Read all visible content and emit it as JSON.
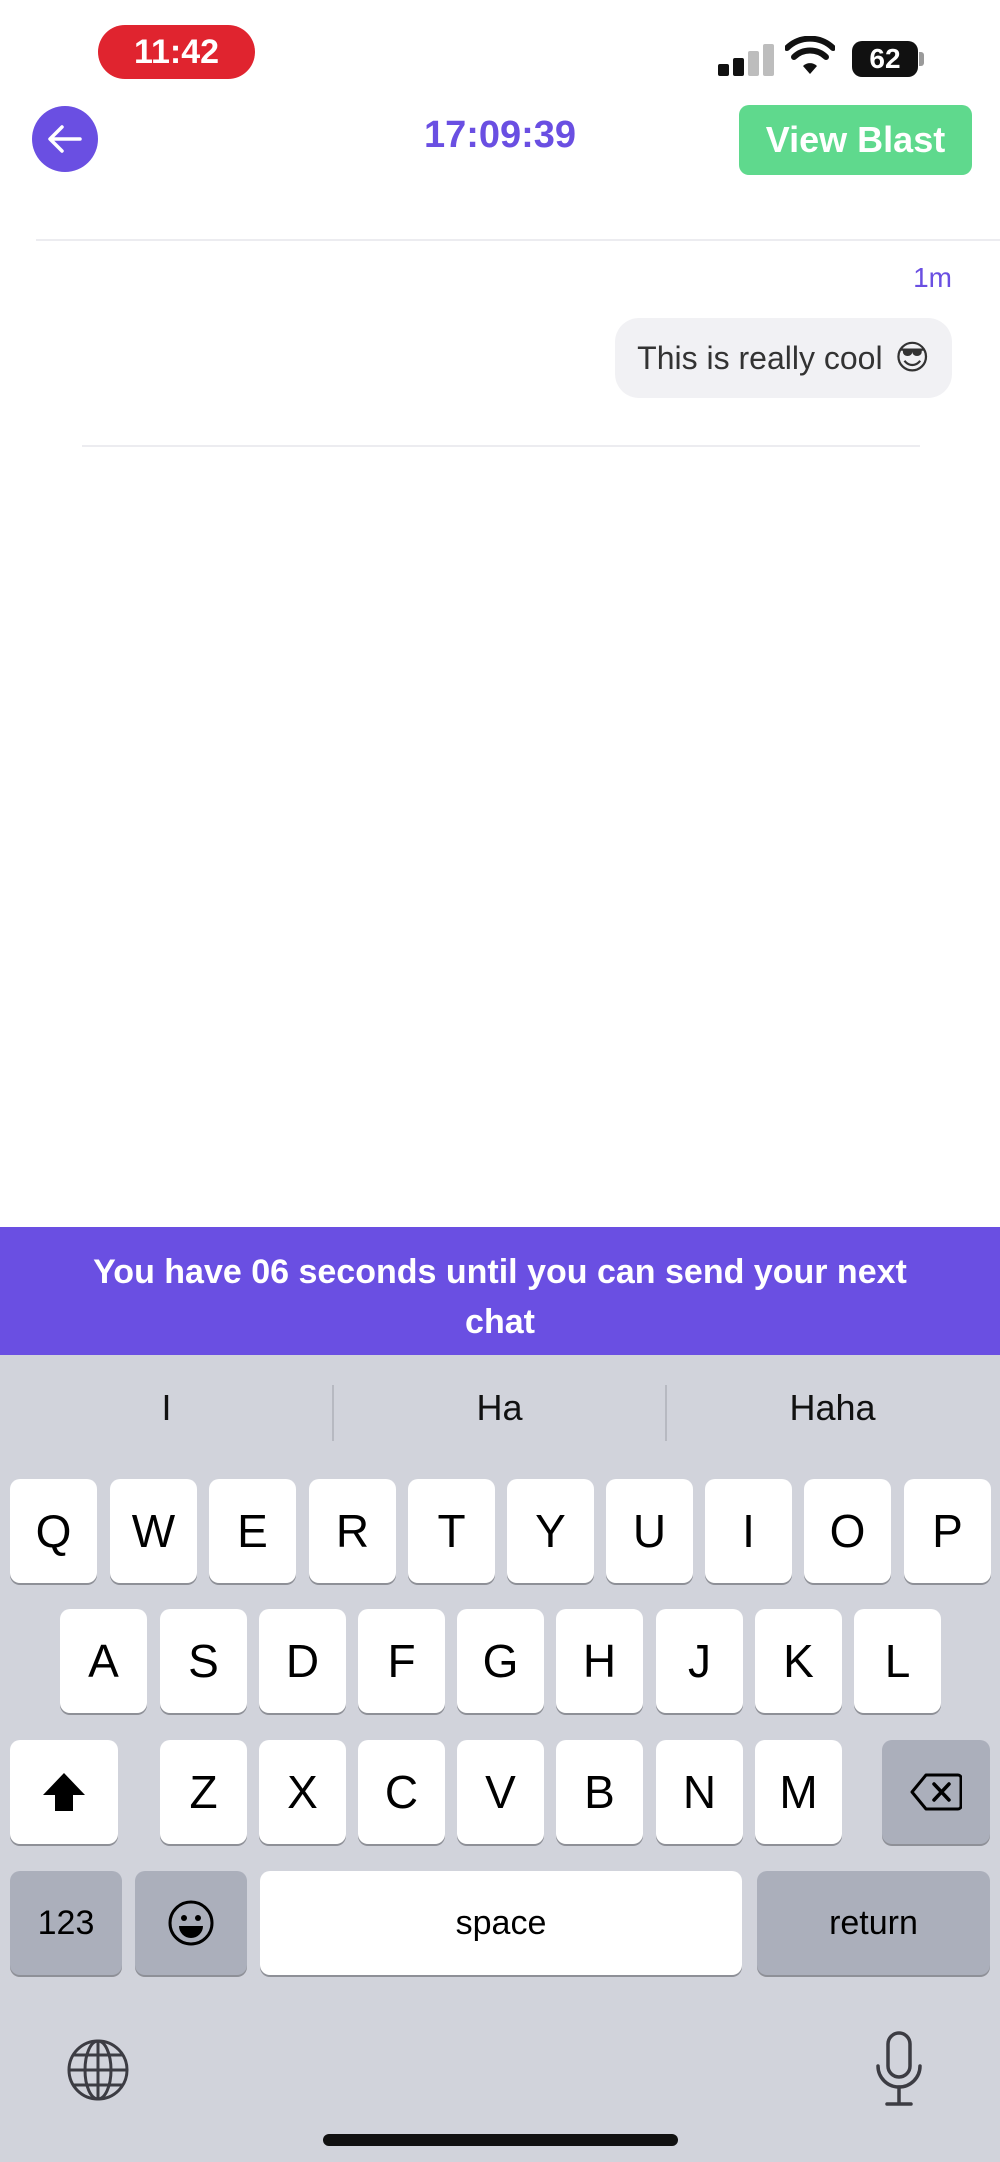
{
  "status_bar": {
    "time": "11:42",
    "battery": "62"
  },
  "header": {
    "timer": "17:09:39",
    "view_blast_label": "View Blast"
  },
  "messages": [
    {
      "time": "1m",
      "text": "This is really cool",
      "emoji": "😎"
    }
  ],
  "cooldown": {
    "text": "You have 06 seconds until you can send your next chat"
  },
  "keyboard": {
    "suggestions": [
      "I",
      "Ha",
      "Haha"
    ],
    "row1": [
      "Q",
      "W",
      "E",
      "R",
      "T",
      "Y",
      "U",
      "I",
      "O",
      "P"
    ],
    "row2": [
      "A",
      "S",
      "D",
      "F",
      "G",
      "H",
      "J",
      "K",
      "L"
    ],
    "row3": [
      "Z",
      "X",
      "C",
      "V",
      "B",
      "N",
      "M"
    ],
    "numbers_label": "123",
    "space_label": "space",
    "return_label": "return"
  },
  "colors": {
    "accent": "#6a4fe2",
    "view_blast": "#5fd98d",
    "time_pill": "#e0242f",
    "keyboard_bg": "#d1d3db"
  }
}
